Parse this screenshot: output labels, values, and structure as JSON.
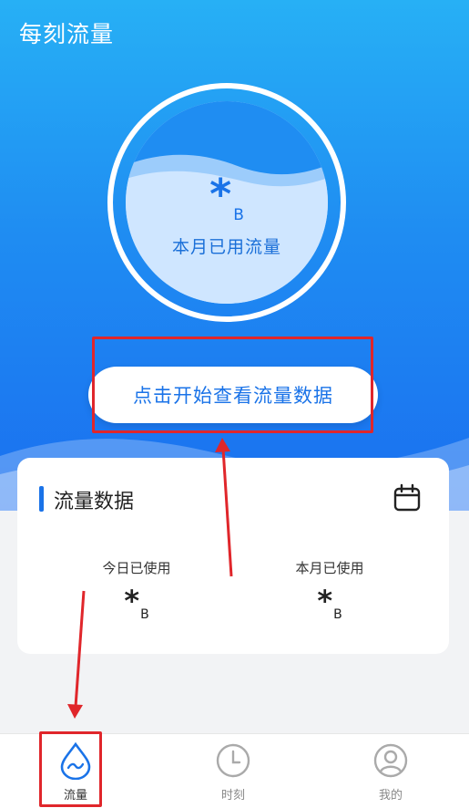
{
  "app": {
    "title": "每刻流量"
  },
  "usage": {
    "value": "*",
    "unit": "B",
    "label": "本月已用流量"
  },
  "start_button": {
    "label": "点击开始查看流量数据"
  },
  "card": {
    "title": "流量数据",
    "stats": [
      {
        "label": "今日已使用",
        "value": "*",
        "unit": "B"
      },
      {
        "label": "本月已使用",
        "value": "*",
        "unit": "B"
      }
    ]
  },
  "tabbar": {
    "items": [
      {
        "label": "流量",
        "icon": "traffic-drop-icon",
        "active": true
      },
      {
        "label": "时刻",
        "icon": "clock-icon",
        "active": false
      },
      {
        "label": "我的",
        "icon": "user-icon",
        "active": false
      }
    ]
  },
  "colors": {
    "accent": "#1a73e8",
    "highlight": "#e0262b"
  }
}
